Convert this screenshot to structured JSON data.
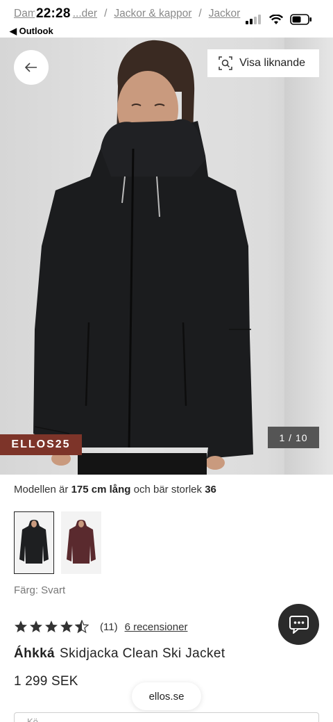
{
  "status_bar": {
    "time": "22:28",
    "back_app": "◀ Outlook"
  },
  "breadcrumb": [
    "Dam",
    "...der",
    "Jackor & kappor",
    "Jackor"
  ],
  "hero": {
    "similar_label": "Visa liknande",
    "promo_code": "ELLOS25",
    "image_counter": "1 / 10"
  },
  "model_info": {
    "prefix": "Modellen är",
    "height": "175 cm lång",
    "middle": "och bär storlek",
    "size": "36"
  },
  "swatches": [
    {
      "name": "Svart",
      "color": "#1e1f21",
      "selected": true
    },
    {
      "name": "Vinröd",
      "color": "#5a2a2e",
      "selected": false
    }
  ],
  "color_label": "Färg: Svart",
  "rating": {
    "stars": 4.5,
    "count": "(11)",
    "reviews_link": "6 recensioner"
  },
  "product": {
    "brand": "Áhkká",
    "name": "Skidjacka Clean Ski Jacket",
    "price": "1 299 SEK"
  },
  "url": "ellos.se",
  "bottom_strip_text": "Kö...",
  "colors": {
    "promo_bg": "#7d3429",
    "chat_bg": "#2b2b2b",
    "jacket": "#1b1c1e"
  }
}
